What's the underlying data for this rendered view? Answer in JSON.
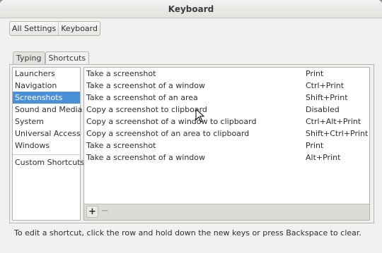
{
  "window": {
    "title": "Keyboard"
  },
  "breadcrumbs": [
    "All Settings",
    "Keyboard"
  ],
  "tabs": [
    {
      "label": "Typing",
      "active": false
    },
    {
      "label": "Shortcuts",
      "active": true
    }
  ],
  "sidebar": {
    "items": [
      {
        "label": "Launchers",
        "selected": false
      },
      {
        "label": "Navigation",
        "selected": false
      },
      {
        "label": "Screenshots",
        "selected": true
      },
      {
        "label": "Sound and Media",
        "selected": false
      },
      {
        "label": "System",
        "selected": false
      },
      {
        "label": "Universal Access",
        "selected": false
      },
      {
        "label": "Windows",
        "selected": false
      }
    ],
    "custom_label": "Custom Shortcuts"
  },
  "shortcuts": [
    {
      "name": "Take a screenshot",
      "accel": "Print"
    },
    {
      "name": "Take a screenshot of a window",
      "accel": "Ctrl+Print"
    },
    {
      "name": "Take a screenshot of an area",
      "accel": "Shift+Print"
    },
    {
      "name": "Copy a screenshot to clipboard",
      "accel": "Disabled"
    },
    {
      "name": "Copy a screenshot of a window to clipboard",
      "accel": "Ctrl+Alt+Print"
    },
    {
      "name": "Copy a screenshot of an area to clipboard",
      "accel": "Shift+Ctrl+Print"
    },
    {
      "name": "Take a screenshot",
      "accel": "Print"
    },
    {
      "name": "Take a screenshot of a window",
      "accel": "Alt+Print"
    }
  ],
  "toolbar": {
    "add_label": "+",
    "remove_label": "−"
  },
  "hint": "To edit a shortcut, click the row and hold down the new keys or press Backspace to clear.",
  "colors": {
    "selection": "#4a90d9",
    "window_bg": "#f2f1f0"
  }
}
